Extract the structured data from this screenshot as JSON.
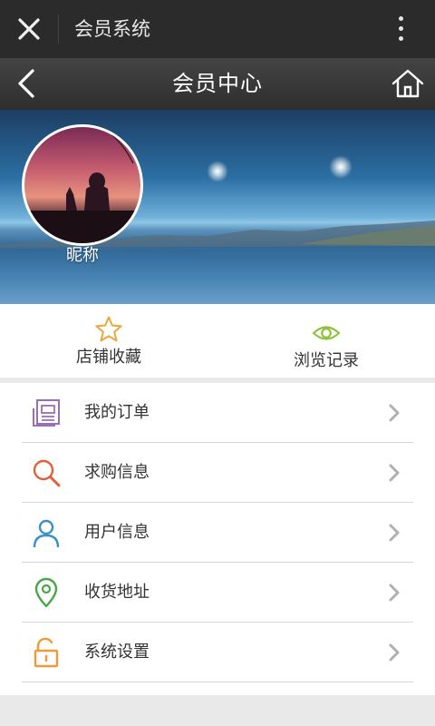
{
  "topbar": {
    "title": "会员系统",
    "close_icon": "close-icon",
    "more_icon": "more-vertical-icon"
  },
  "navbar": {
    "title": "会员中心",
    "back_icon": "chevron-left-icon",
    "home_icon": "home-icon"
  },
  "profile": {
    "nickname": "昵称"
  },
  "quick_actions": [
    {
      "label": "店铺收藏",
      "icon": "star-icon",
      "color": "#e6a93b"
    },
    {
      "label": "浏览记录",
      "icon": "eye-icon",
      "color": "#8fc23c"
    }
  ],
  "menu": [
    {
      "label": "我的订单",
      "icon": "order-document-icon",
      "color": "#9a6fb0"
    },
    {
      "label": "求购信息",
      "icon": "search-icon",
      "color": "#e0603a"
    },
    {
      "label": "用户信息",
      "icon": "user-icon",
      "color": "#3a8fc9"
    },
    {
      "label": "收货地址",
      "icon": "location-pin-icon",
      "color": "#4aa54a"
    },
    {
      "label": "系统设置",
      "icon": "unlock-icon",
      "color": "#f0993a"
    }
  ],
  "colors": {
    "topbar": "#2b2b2b",
    "page_background": "#e9e9e9",
    "chevron": "#b0b0b0"
  }
}
